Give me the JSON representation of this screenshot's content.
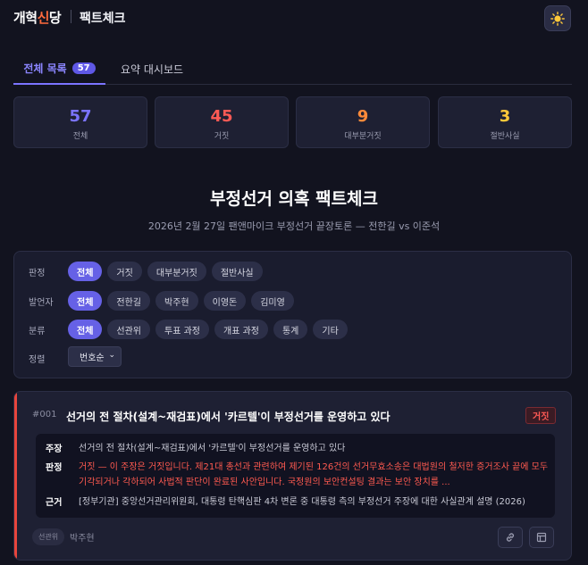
{
  "header": {
    "logo_part1": "개혁",
    "logo_part2": "신",
    "logo_part3": "당",
    "title": "팩트체크",
    "theme_icon": "sun-icon"
  },
  "tabs": [
    {
      "label": "전체 목록",
      "badge": "57",
      "active": true
    },
    {
      "label": "요약 대시보드",
      "active": false
    }
  ],
  "stats": [
    {
      "value": "57",
      "label": "전체",
      "color": "#7b74ff"
    },
    {
      "value": "45",
      "label": "거짓",
      "color": "#ff5a55"
    },
    {
      "value": "9",
      "label": "대부분거짓",
      "color": "#ff8a3a"
    },
    {
      "value": "3",
      "label": "절반사실",
      "color": "#ffc83a"
    }
  ],
  "page": {
    "title": "부정선거 의혹 팩트체크",
    "subtitle": "2026년 2월 27일 팬앤마이크 부정선거 끝장토론 — 전한길 vs 이준석"
  },
  "filters": {
    "verdict": {
      "label": "판정",
      "options": [
        "전체",
        "거짓",
        "대부분거짓",
        "절반사실"
      ],
      "selected": "전체"
    },
    "speaker": {
      "label": "발언자",
      "options": [
        "전체",
        "전한길",
        "박주현",
        "이영돈",
        "김미영"
      ],
      "selected": "전체"
    },
    "category": {
      "label": "분류",
      "options": [
        "전체",
        "선관위",
        "투표 과정",
        "개표 과정",
        "통계",
        "기타"
      ],
      "selected": "전체"
    },
    "sort": {
      "label": "정렬",
      "value": "번호순"
    }
  },
  "card": {
    "number": "#001",
    "title": "선거의 전 절차(설계~재검표)에서 '카르텔'이 부정선거를 운영하고 있다",
    "verdict": "거짓",
    "claim_label": "주장",
    "claim": "선거의 전 절차(설계~재검표)에서 '카르텔'이 부정선거를 운영하고 있다",
    "ruling_label": "판정",
    "ruling": "거짓 — 이 주장은 거짓입니다. 제21대 총선과 관련하여 제기된 126건의 선거무효소송은 대법원의 철저한 증거조사 끝에 모두 기각되거나 각하되어 사법적 판단이 완료된 사안입니다. 국정원의 보안컨설팅 결과는 보안 장치를 ...",
    "basis_label": "근거",
    "basis": "[정부기관] 중앙선거관리위원회, 대통령 탄핵심판 4차 변론 중 대통령 측의 부정선거 주장에 대한 사실관계 설명 (2026)",
    "category": "선관위",
    "speaker": "박주현"
  }
}
